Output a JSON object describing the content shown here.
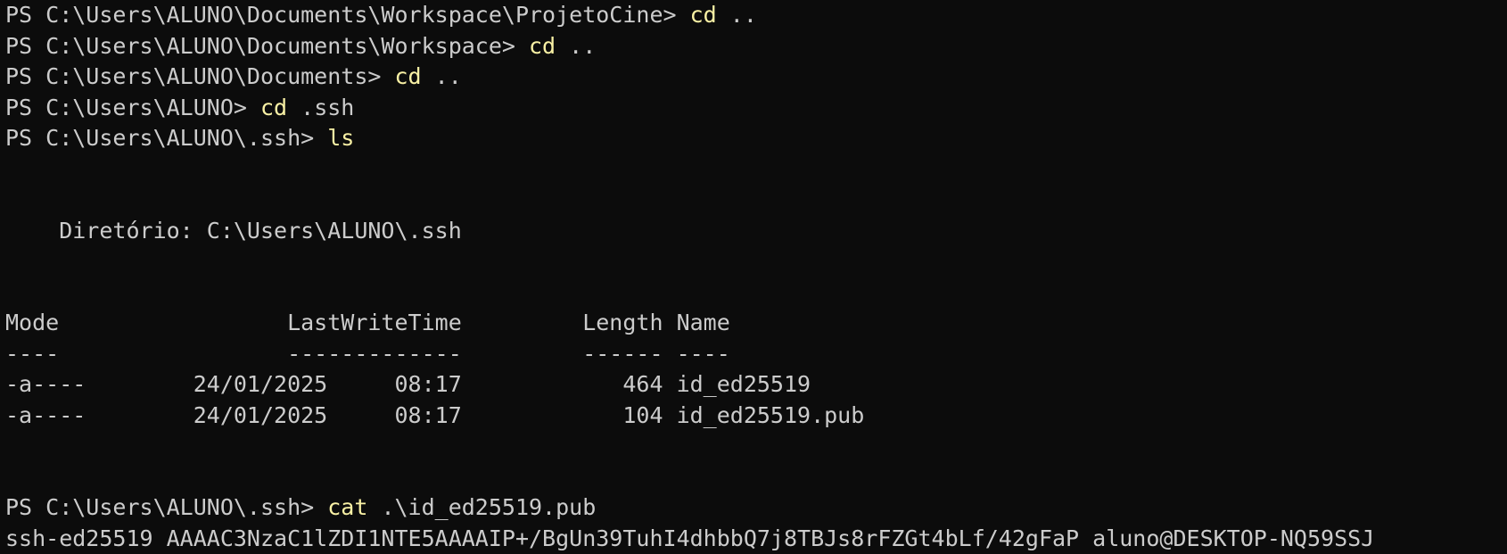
{
  "colors": {
    "background": "#0c0c0c",
    "foreground": "#cccccc",
    "command": "#f9f1a5"
  },
  "history": [
    {
      "prompt": "PS C:\\Users\\ALUNO\\Documents\\Workspace\\ProjetoCine> ",
      "command": "cd",
      "args": " .."
    },
    {
      "prompt": "PS C:\\Users\\ALUNO\\Documents\\Workspace> ",
      "command": "cd",
      "args": " .."
    },
    {
      "prompt": "PS C:\\Users\\ALUNO\\Documents> ",
      "command": "cd",
      "args": " .."
    },
    {
      "prompt": "PS C:\\Users\\ALUNO> ",
      "command": "cd",
      "args": " .ssh"
    },
    {
      "prompt": "PS C:\\Users\\ALUNO\\.ssh> ",
      "command": "ls",
      "args": ""
    }
  ],
  "listing": {
    "directory_line": "    Diretório: C:\\Users\\ALUNO\\.ssh",
    "header": "Mode                 LastWriteTime         Length Name",
    "separator": "----                 -------------         ------ ----",
    "rows": [
      "-a----        24/01/2025     08:17            464 id_ed25519",
      "-a----        24/01/2025     08:17            104 id_ed25519.pub"
    ]
  },
  "last_command": {
    "prompt": "PS C:\\Users\\ALUNO\\.ssh> ",
    "command": "cat",
    "args": " .\\id_ed25519.pub"
  },
  "output": "ssh-ed25519 AAAAC3NzaC1lZDI1NTE5AAAAIP+/BgUn39TuhI4dhbbQ7j8TBJs8rFZGt4bLf/42gFaP aluno@DESKTOP-NQ59SSJ"
}
